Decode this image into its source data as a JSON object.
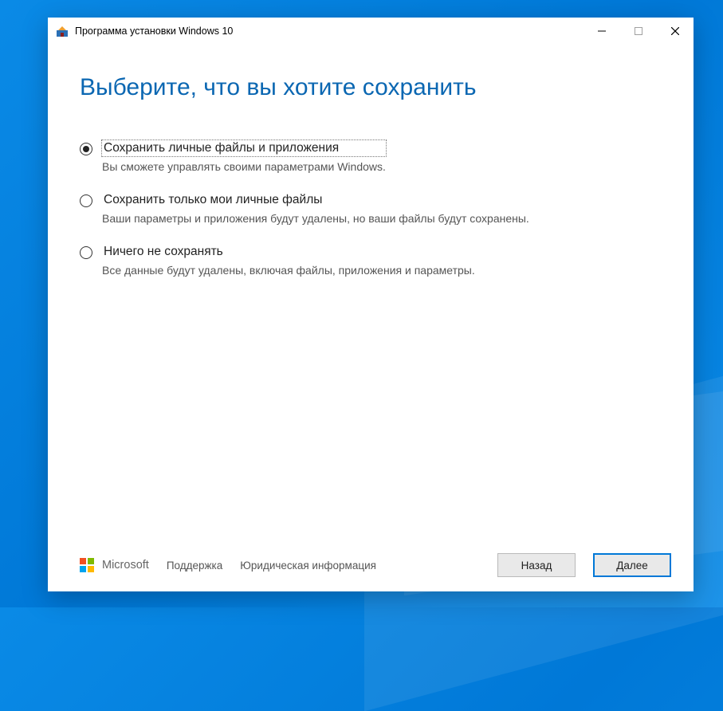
{
  "window": {
    "title": "Программа установки Windows 10"
  },
  "heading": "Выберите, что вы хотите сохранить",
  "options": [
    {
      "label": "Сохранить личные файлы и приложения",
      "desc": "Вы сможете управлять своими параметрами Windows.",
      "selected": true,
      "focused": true
    },
    {
      "label": "Сохранить только мои личные файлы",
      "desc": "Ваши параметры и приложения будут удалены, но ваши файлы будут сохранены.",
      "selected": false,
      "focused": false
    },
    {
      "label": "Ничего не сохранять",
      "desc": "Все данные будут удалены, включая файлы, приложения и параметры.",
      "selected": false,
      "focused": false
    }
  ],
  "footer": {
    "brand": "Microsoft",
    "support": "Поддержка",
    "legal": "Юридическая информация",
    "back": "Назад",
    "next": "Далее"
  }
}
